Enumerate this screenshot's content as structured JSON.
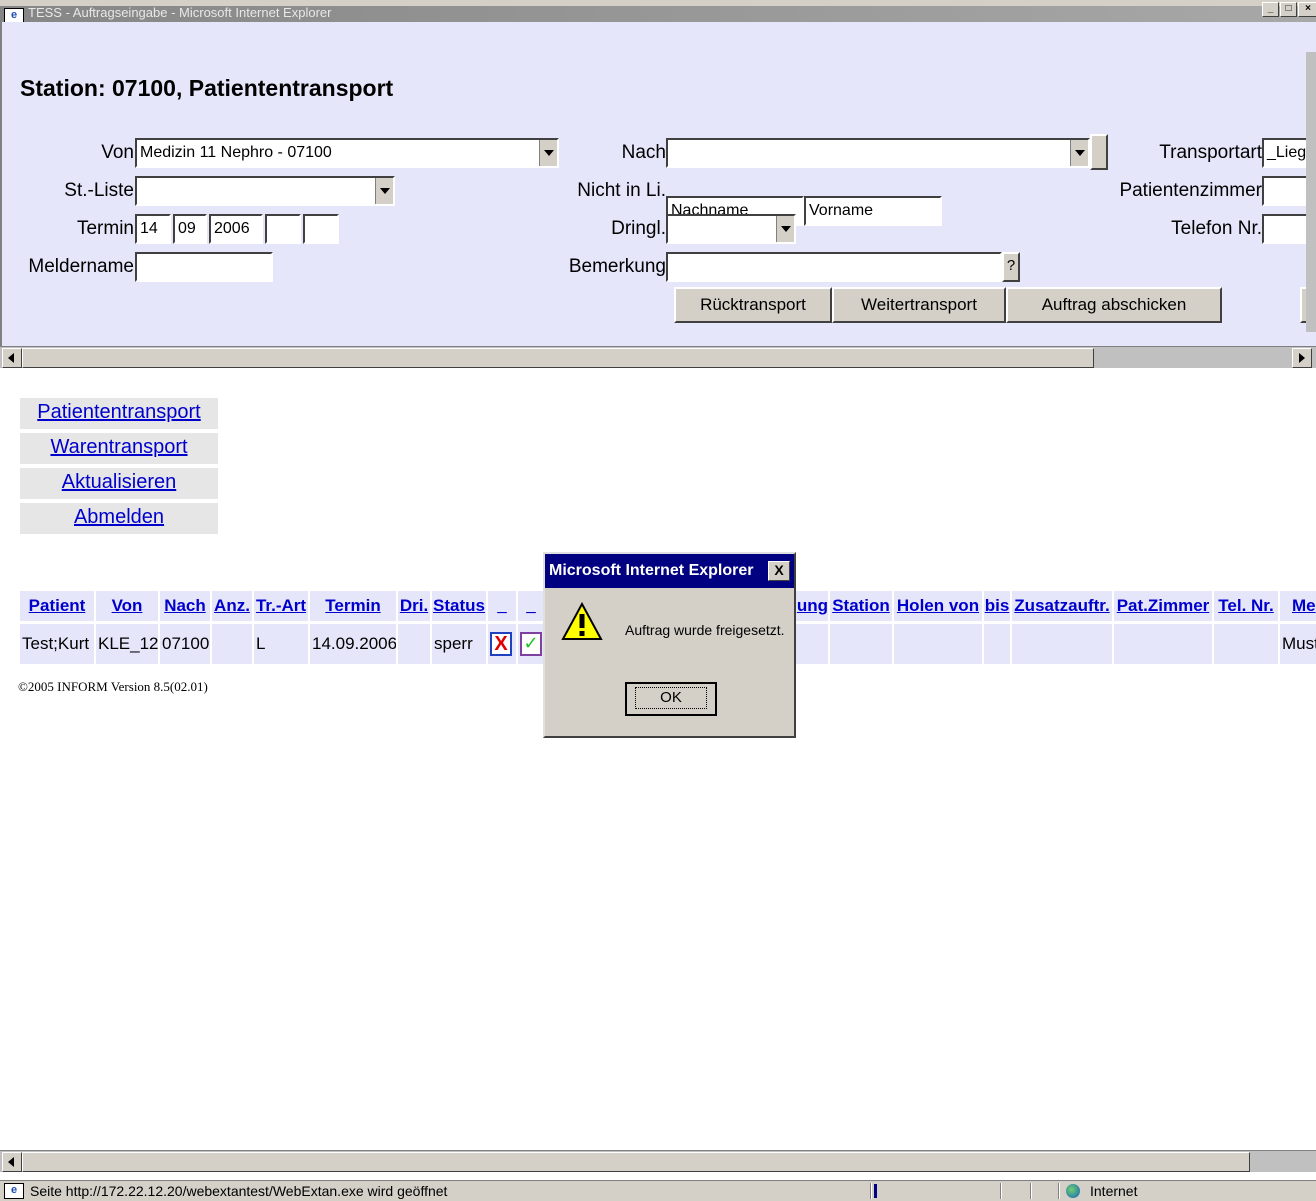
{
  "window": {
    "title": "TESS - Auftragseingabe - Microsoft Internet Explorer"
  },
  "form": {
    "heading": "Station: 07100, Patiententransport",
    "von_label": "Von",
    "von_value": "Medizin 11 Nephro - 07100",
    "nach_label": "Nach",
    "nach_value": "",
    "transportart_label": "Transportart",
    "transportart_value": "_Lieg",
    "stliste_label": "St.-Liste",
    "stliste_value": "",
    "nichtinli_label": "Nicht in Li.",
    "nachname_value": "Nachname",
    "vorname_value": "Vorname",
    "patientenzimmer_label": "Patientenzimmer",
    "termin_label": "Termin",
    "termin_day": "14",
    "termin_month": "09",
    "termin_year": "2006",
    "termin_hour": "",
    "termin_min": "",
    "dringl_label": "Dringl.",
    "telefon_label": "Telefon Nr.",
    "meldername_label": "Meldername",
    "bemerkung_label": "Bemerkung",
    "bemerkung_help": "?",
    "buttons": {
      "ruecktransport": "Rücktransport",
      "weitertransport": "Weitertransport",
      "abschicken": "Auftrag abschicken"
    }
  },
  "nav": [
    {
      "label": "Patiententransport"
    },
    {
      "label": "Warentransport"
    },
    {
      "label": "Aktualisieren"
    },
    {
      "label": "Abmelden"
    }
  ],
  "table": {
    "headers": [
      "Patient",
      "Von",
      "Nach",
      "Anz.",
      "Tr.-Art",
      "Termin",
      "Dri.",
      "Status",
      "_",
      "_",
      "ung",
      "Station",
      "Holen von",
      "bis",
      "Zusatzauftr.",
      "Pat.Zimmer",
      "Tel. Nr.",
      "Me"
    ],
    "row": [
      "Test;Kurt",
      "KLE_12",
      "07100",
      "",
      "L",
      "14.09.2006",
      "",
      "sperr",
      "",
      "",
      "",
      "",
      "",
      "",
      "",
      "",
      "",
      "Must"
    ]
  },
  "footer": {
    "version": "©2005 INFORM Version 8.5(02.01)"
  },
  "dialog": {
    "title": "Microsoft Internet Explorer",
    "message": "Auftrag wurde freigesetzt.",
    "ok": "OK",
    "close": "X"
  },
  "statusbar": {
    "text": "Seite http://172.22.12.20/webextantest/WebExtan.exe wird geöffnet",
    "zone": "Internet"
  },
  "colors": {
    "frame_bg": "#e6e6fa",
    "link": "#0000cc",
    "dialog_title": "#000080"
  }
}
